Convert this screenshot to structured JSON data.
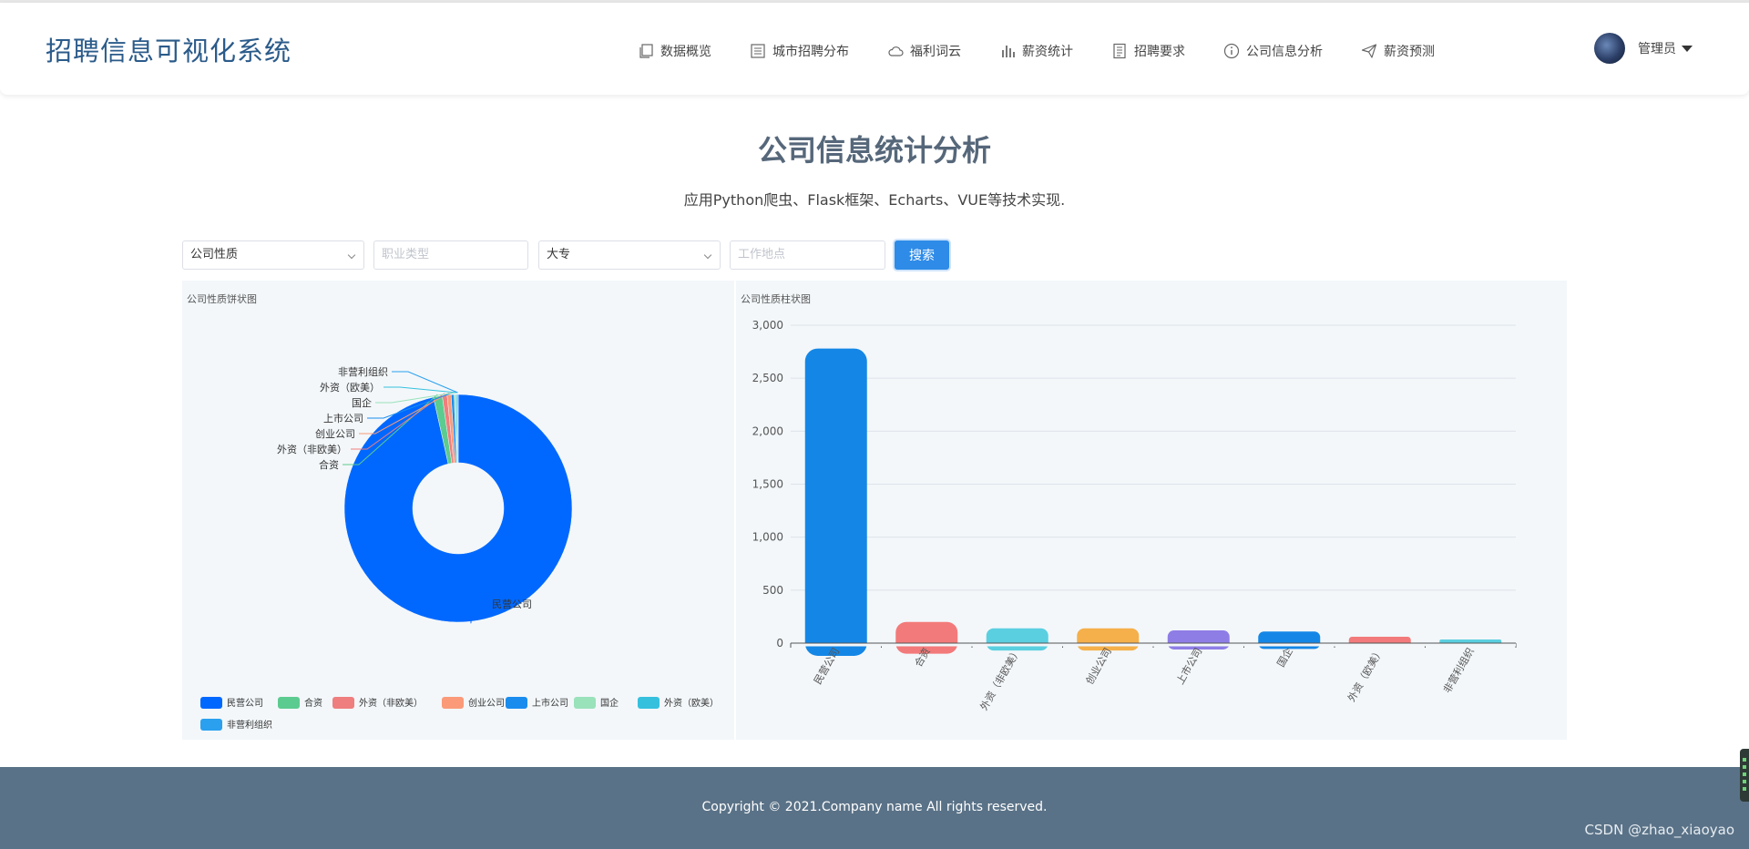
{
  "header": {
    "brand": "招聘信息可视化系统",
    "nav": [
      {
        "label": "数据概览",
        "icon": "copy-icon"
      },
      {
        "label": "城市招聘分布",
        "icon": "list-icon"
      },
      {
        "label": "福利词云",
        "icon": "cloud-icon"
      },
      {
        "label": "薪资统计",
        "icon": "bar-chart-icon"
      },
      {
        "label": "招聘要求",
        "icon": "document-icon"
      },
      {
        "label": "公司信息分析",
        "icon": "info-icon"
      },
      {
        "label": "薪资预测",
        "icon": "send-icon"
      }
    ],
    "user": {
      "name": "管理员"
    }
  },
  "main": {
    "title": "公司信息统计分析",
    "subtitle": "应用Python爬虫、Flask框架、Echarts、VUE等技术实现."
  },
  "filters": {
    "company_type": "公司性质",
    "job_type_placeholder": "职业类型",
    "education": "大专",
    "location_placeholder": "工作地点",
    "search_label": "搜索"
  },
  "pie_panel": {
    "title": "公司性质饼状图"
  },
  "bar_panel": {
    "title": "公司性质柱状图"
  },
  "colors": {
    "accent": "#2e8be8",
    "footer": "#5a7287",
    "title": "#56677a"
  },
  "chart_data": [
    {
      "type": "pie",
      "donut": true,
      "legend_position": "bottom",
      "slices": [
        {
          "name": "民营公司",
          "value": 2780,
          "color": "#0068ff"
        },
        {
          "name": "合资",
          "value": 36,
          "color": "#5ccb8f"
        },
        {
          "name": "外资（非欧美）",
          "value": 20,
          "color": "#ef7e7e"
        },
        {
          "name": "创业公司",
          "value": 16,
          "color": "#fa9a78"
        },
        {
          "name": "上市公司",
          "value": 12,
          "color": "#1a8cee"
        },
        {
          "name": "国企",
          "value": 8,
          "color": "#99e2ba"
        },
        {
          "name": "外资（欧美）",
          "value": 5,
          "color": "#35c1de"
        },
        {
          "name": "非营利组织",
          "value": 3,
          "color": "#2aa0ef"
        }
      ]
    },
    {
      "type": "bar",
      "categories": [
        "民营公司",
        "合资",
        "外资（非欧美）",
        "创业公司",
        "上市公司",
        "国企",
        "外资（欧美）",
        "非营利组织"
      ],
      "values": [
        2780,
        200,
        140,
        140,
        120,
        110,
        60,
        10
      ],
      "colors": [
        "#1487e6",
        "#f37a7a",
        "#5acfe0",
        "#f5b04b",
        "#8f7de6",
        "#1487e6",
        "#f37a7a",
        "#5acfe0"
      ],
      "ylim": [
        0,
        3000
      ],
      "yticks": [
        0,
        500,
        1000,
        1500,
        2000,
        2500,
        3000
      ],
      "ytick_labels": [
        "0",
        "500",
        "1,000",
        "1,500",
        "2,000",
        "2,500",
        "3,000"
      ],
      "grid": true
    }
  ],
  "footer": {
    "copyright": "Copyright © 2021.Company name All rights reserved.",
    "watermark": "CSDN @zhao_xiaoyao"
  }
}
